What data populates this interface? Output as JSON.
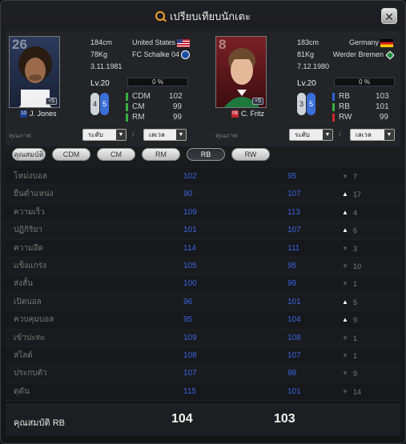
{
  "title": "เปรียบเทียบนักเตะ",
  "players": [
    {
      "ovr": "26",
      "name": "J. Jones",
      "team_badge": "10",
      "height": "184cm",
      "weight": "78Kg",
      "birth": "3.11.1981",
      "nation": "United States",
      "club": "FC Schalke 04",
      "level": "Lv.20",
      "progress": "0 %",
      "skill_a": "4",
      "skill_b": "5",
      "upgrade": "+5",
      "positions": [
        {
          "name": "CDM",
          "value": "102",
          "color": "#3cb043"
        },
        {
          "name": "CM",
          "value": "99",
          "color": "#3cb043"
        },
        {
          "name": "RM",
          "value": "99",
          "color": "#3cb043"
        }
      ]
    },
    {
      "ovr": "8",
      "name": "C. Fritz",
      "team_badge": "08",
      "height": "183cm",
      "weight": "81Kg",
      "birth": "7.12.1980",
      "nation": "Germany",
      "club": "Werder Bremen",
      "level": "Lv.20",
      "progress": "0 %",
      "skill_a": "3",
      "skill_b": "5",
      "upgrade": "+5",
      "positions": [
        {
          "name": "RB",
          "value": "103",
          "color": "#2f63d6"
        },
        {
          "name": "RB",
          "value": "101",
          "color": "#3cb043"
        },
        {
          "name": "RW",
          "value": "99",
          "color": "#d12a2a"
        }
      ]
    }
  ],
  "filters": {
    "label": "คุณภาพ",
    "grade": "ระดับ",
    "level": "เลเวล",
    "slash": "/"
  },
  "tabs": [
    "คุณสมบัติ",
    "CDM",
    "CM",
    "RM",
    "RB",
    "RW"
  ],
  "active_tab": 4,
  "stats": [
    {
      "name": "โหม่งบอล",
      "v1": "102",
      "v2": "95",
      "dir": "down",
      "diff": "7"
    },
    {
      "name": "ยืนตำแหน่ง",
      "v1": "90",
      "v2": "107",
      "dir": "up",
      "diff": "17"
    },
    {
      "name": "ความเร็ว",
      "v1": "109",
      "v2": "113",
      "dir": "up",
      "diff": "4"
    },
    {
      "name": "ปฏิกิริยา",
      "v1": "101",
      "v2": "107",
      "dir": "up",
      "diff": "6"
    },
    {
      "name": "ความอึด",
      "v1": "114",
      "v2": "111",
      "dir": "down",
      "diff": "3"
    },
    {
      "name": "แข็งแกร่ง",
      "v1": "105",
      "v2": "95",
      "dir": "down",
      "diff": "10"
    },
    {
      "name": "ส่งสั้น",
      "v1": "100",
      "v2": "99",
      "dir": "down",
      "diff": "1"
    },
    {
      "name": "เปิดบอล",
      "v1": "96",
      "v2": "101",
      "dir": "up",
      "diff": "5"
    },
    {
      "name": "ควบคุมบอล",
      "v1": "95",
      "v2": "104",
      "dir": "up",
      "diff": "9"
    },
    {
      "name": "เข้าปะทะ",
      "v1": "109",
      "v2": "108",
      "dir": "down",
      "diff": "1"
    },
    {
      "name": "สไลด์",
      "v1": "108",
      "v2": "107",
      "dir": "down",
      "diff": "1"
    },
    {
      "name": "ประกบตัว",
      "v1": "107",
      "v2": "98",
      "dir": "down",
      "diff": "9"
    },
    {
      "name": "ดุดัน",
      "v1": "115",
      "v2": "101",
      "dir": "down",
      "diff": "14"
    }
  ],
  "footer": {
    "label": "คุณสมบัติ RB",
    "v1": "104",
    "v2": "103"
  }
}
